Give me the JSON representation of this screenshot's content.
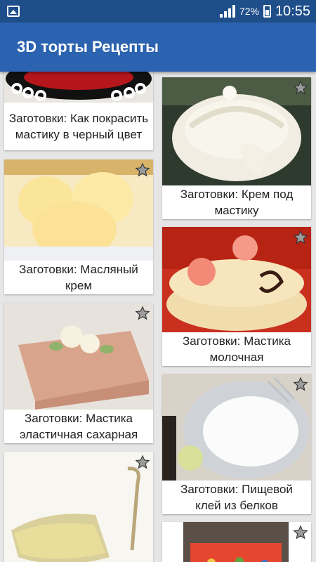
{
  "status": {
    "battery": "72%",
    "time": "10:55"
  },
  "app": {
    "title": "3D торты Рецепты"
  },
  "cards": [
    {
      "caption": "Заготовки: Как покрасить мастику в черный цвет"
    },
    {
      "caption": "Заготовки: Крем под мастику"
    },
    {
      "caption": "Заготовки: Масляный крем"
    },
    {
      "caption": "Заготовки: Мастика молочная"
    },
    {
      "caption": "Заготовки: Мастика эластичная сахарная"
    },
    {
      "caption": "Заготовки: Пищевой клей из белков"
    }
  ]
}
